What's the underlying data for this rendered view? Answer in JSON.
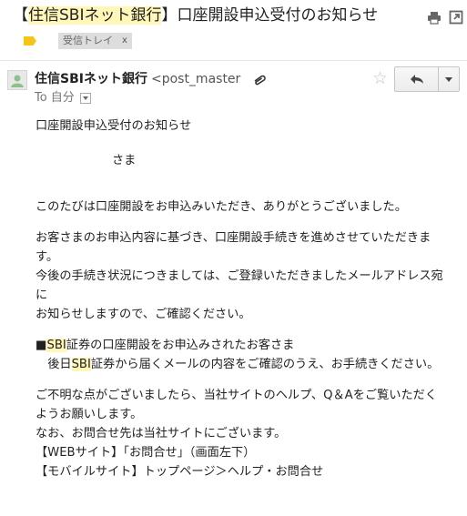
{
  "subject": {
    "bracket_open": "【",
    "bank_highlight": "住信SBIネット銀行",
    "rest": "】口座開設申込受付のお知らせ"
  },
  "labels": {
    "inbox_chip": "受信トレイ",
    "chip_close": "x"
  },
  "sender": {
    "name": "住信SBIネット銀行",
    "address": "<post_master",
    "to_prefix": "To",
    "to_value": "自分"
  },
  "body": {
    "line_title": "口座開設申込受付のお知らせ",
    "line_sama": "さま",
    "line_thanks": "このたびは口座開設をお申込みいただき、ありがとうございました。",
    "para2": [
      "お客さまのお申込内容に基づき、口座開設手続きを進めさせていただきます。",
      "今後の手続き状況につきましては、ご登録いただきましたメールアドレス宛に",
      "お知らせしますので、ご確認ください。"
    ],
    "sbi_note": {
      "mark": "■",
      "hl1": "SBI",
      "text1": "証券の口座開設をお申込みされたお客さま",
      "text2a": "後日",
      "hl2": "SBI",
      "text2b": "証券から届くメールの内容をご確認のうえ、お手続きください。"
    },
    "para4": [
      "ご不明な点がございましたら、当社サイトのヘルプ、Q＆Aをご覧いただくようお願いします。",
      "なお、お問合せ先は当社サイトにございます。",
      "【WEBサイト】「お問合せ」（画面左下）",
      "【モバイルサイト】トップページ＞ヘルプ・お問合せ"
    ]
  },
  "colors": {
    "highlight": "#fff6b8",
    "label_tag": "#f5c518",
    "chip_bg": "#dddddd"
  },
  "icons": [
    "print-icon",
    "new-window-icon",
    "label-tag-icon",
    "avatar-icon",
    "attachment-icon",
    "star-icon",
    "reply-icon",
    "chevron-down-icon"
  ]
}
